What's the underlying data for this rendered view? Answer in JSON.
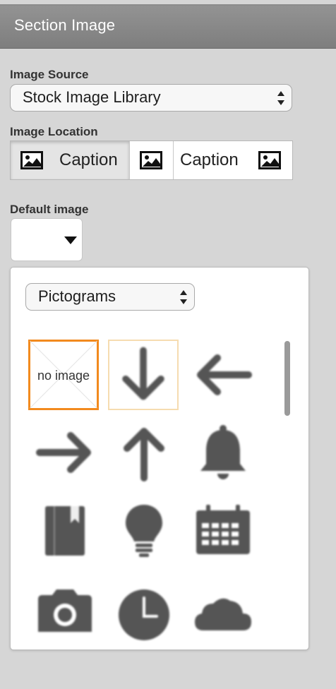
{
  "section": {
    "title": "Section Image"
  },
  "image_source": {
    "label": "Image Source",
    "selected": "Stock Image Library"
  },
  "image_location": {
    "label": "Image Location",
    "options": [
      {
        "caption": "Caption",
        "icon": "image-icon",
        "selected": true
      },
      {
        "caption": "",
        "icon": "image-icon",
        "selected": false
      },
      {
        "caption": "Caption",
        "icon": "image-icon",
        "selected": false
      }
    ]
  },
  "default_image": {
    "label": "Default image"
  },
  "picker": {
    "category_selected": "Pictograms",
    "no_image_text": "no image",
    "icons": [
      "no-image",
      "arrow-down-icon",
      "arrow-left-icon",
      "arrow-right-icon",
      "arrow-up-icon",
      "bell-icon",
      "book-icon",
      "lightbulb-icon",
      "calendar-icon",
      "camera-icon",
      "clock-icon",
      "cloud-icon"
    ]
  },
  "colors": {
    "header": "#8a8a8a",
    "selection": "#f28a1e",
    "icon": "#555555"
  }
}
